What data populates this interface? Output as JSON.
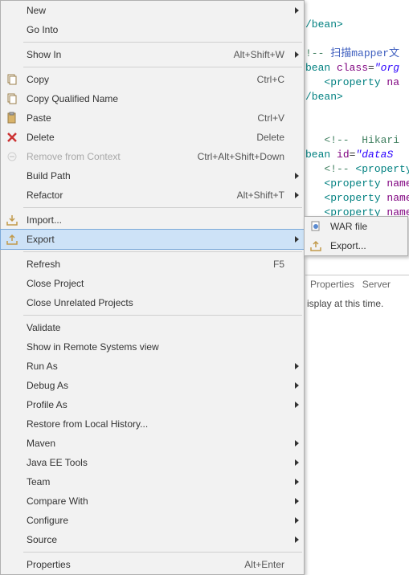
{
  "menu": {
    "new": "New",
    "go_into": "Go Into",
    "show_in": "Show In",
    "show_in_accel": "Alt+Shift+W",
    "copy": "Copy",
    "copy_accel": "Ctrl+C",
    "copy_qn": "Copy Qualified Name",
    "paste": "Paste",
    "paste_accel": "Ctrl+V",
    "delete": "Delete",
    "delete_accel": "Delete",
    "remove_ctx": "Remove from Context",
    "remove_ctx_accel": "Ctrl+Alt+Shift+Down",
    "build_path": "Build Path",
    "refactor": "Refactor",
    "refactor_accel": "Alt+Shift+T",
    "import": "Import...",
    "export": "Export",
    "refresh": "Refresh",
    "refresh_accel": "F5",
    "close_project": "Close Project",
    "close_unrelated": "Close Unrelated Projects",
    "validate": "Validate",
    "show_remote": "Show in Remote Systems view",
    "run_as": "Run As",
    "debug_as": "Debug As",
    "profile_as": "Profile As",
    "restore_history": "Restore from Local History...",
    "maven": "Maven",
    "javaee": "Java EE Tools",
    "team": "Team",
    "compare_with": "Compare With",
    "configure": "Configure",
    "source": "Source",
    "properties": "Properties",
    "properties_accel": "Alt+Enter"
  },
  "submenu": {
    "war": "WAR file",
    "export": "Export..."
  },
  "code": {
    "l1": "/bean>",
    "l2a": "!-- ",
    "l2b": "扫描mapper文",
    "l3a": "bean ",
    "l3b": "class",
    "l3c": "=",
    "l3d": "\"org",
    "l4a": "<property ",
    "l4b": "na",
    "l5": "/bean>",
    "l6": "<!--  Hikari",
    "l7a": "bean ",
    "l7b": "id",
    "l7c": "=",
    "l7d": "\"dataS",
    "l8a": "<!-- ",
    "l8b": "<property",
    "l9a": "<property ",
    "l9b": "name",
    "l10a": "<property ",
    "l10b": "name",
    "l11a": "<property ",
    "l11b": "name"
  },
  "tabs": {
    "properties": "Properties",
    "servers": "Server",
    "msg": "isplay at this time."
  }
}
